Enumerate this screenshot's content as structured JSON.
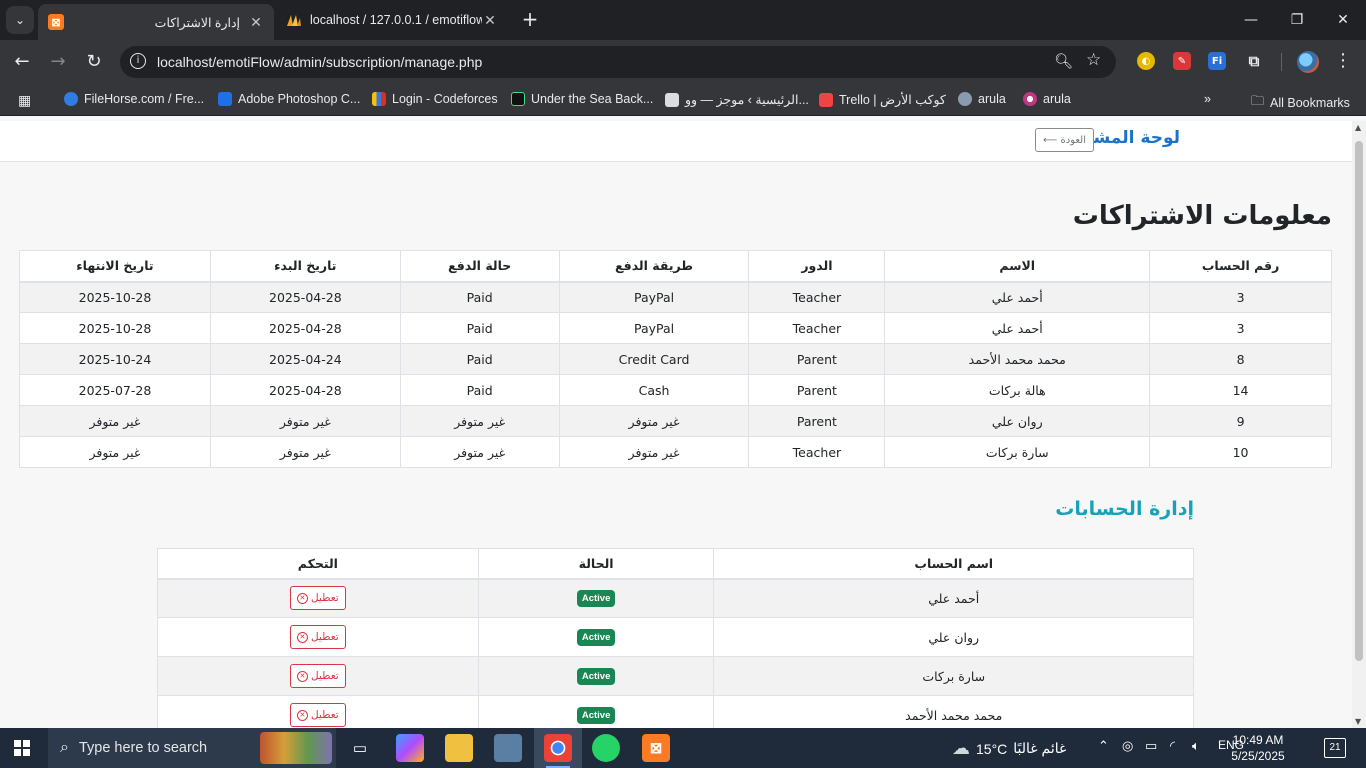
{
  "browser": {
    "tabs": [
      {
        "title": "إدارة الاشتراكات",
        "active": true
      },
      {
        "title": "localhost / 127.0.0.1 / emotiflow",
        "active": false
      }
    ],
    "url": "localhost/emotiFlow/admin/subscription/manage.php",
    "bookmarks": [
      "FileHorse.com / Fre...",
      "Adobe Photoshop C...",
      "Login - Codeforces",
      "Under the Sea Back...",
      "الرئيسية › موجز — وو...",
      "Trello | كوكب الأرض",
      "arula",
      "arula"
    ],
    "all_bookmarks": "All Bookmarks"
  },
  "page": {
    "brand": "لوحة المشرف",
    "back_button": "العودة ⟵",
    "subscriptions_title": "معلومات الاشتراكات",
    "subscriptions_headers": [
      "رقم الحساب",
      "الاسم",
      "الدور",
      "طريقة الدفع",
      "حالة الدفع",
      "تاريخ البدء",
      "تاريخ الانتهاء"
    ],
    "subscriptions": [
      [
        "3",
        "أحمد علي",
        "Teacher",
        "PayPal",
        "Paid",
        "2025-04-28",
        "2025-10-28"
      ],
      [
        "3",
        "أحمد علي",
        "Teacher",
        "PayPal",
        "Paid",
        "2025-04-28",
        "2025-10-28"
      ],
      [
        "8",
        "محمد محمد الأحمد",
        "Parent",
        "Credit Card",
        "Paid",
        "2025-04-24",
        "2025-10-24"
      ],
      [
        "14",
        "هالة بركات",
        "Parent",
        "Cash",
        "Paid",
        "2025-04-28",
        "2025-07-28"
      ],
      [
        "9",
        "روان علي",
        "Parent",
        "غير متوفر",
        "غير متوفر",
        "غير متوفر",
        "غير متوفر"
      ],
      [
        "10",
        "سارة بركات",
        "Teacher",
        "غير متوفر",
        "غير متوفر",
        "غير متوفر",
        "غير متوفر"
      ]
    ],
    "accounts_title": "إدارة الحسابات",
    "accounts_headers": [
      "اسم الحساب",
      "الحالة",
      "التحكم"
    ],
    "accounts": [
      {
        "name": "أحمد علي",
        "status": "Active",
        "action": "تعطيل"
      },
      {
        "name": "روان علي",
        "status": "Active",
        "action": "تعطيل"
      },
      {
        "name": "سارة بركات",
        "status": "Active",
        "action": "تعطيل"
      },
      {
        "name": "محمد محمد الأحمد",
        "status": "Active",
        "action": "تعطيل"
      }
    ]
  },
  "taskbar": {
    "search_placeholder": "Type here to search",
    "weather_temp": "15°C",
    "weather_desc": "غائم غالبًا",
    "language": "ENG",
    "time": "10:49 AM",
    "date": "5/25/2025",
    "notifications": "21"
  },
  "colors": {
    "brand": "#1a73c8",
    "accounts_title": "#17a2b8",
    "active_badge": "#198754",
    "disable_button": "#dc3545"
  }
}
